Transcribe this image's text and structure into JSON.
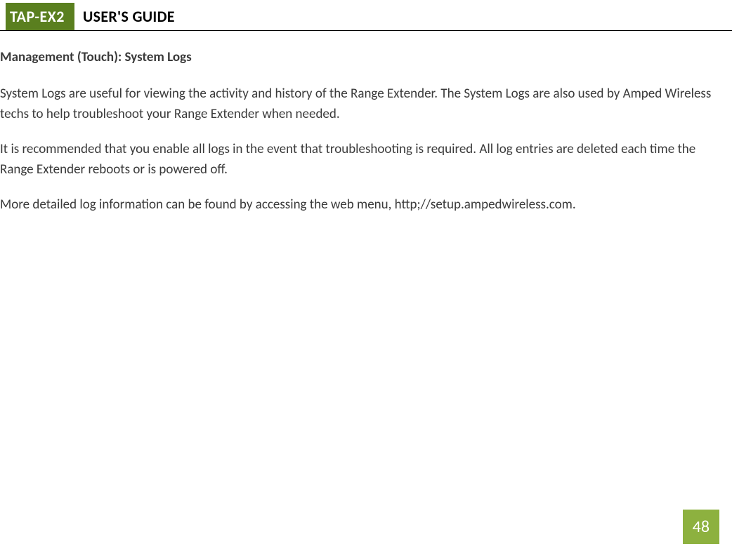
{
  "header": {
    "product": "TAP-EX2",
    "title": "USER'S GUIDE"
  },
  "section": {
    "heading": "Management (Touch): System Logs"
  },
  "paragraphs": {
    "p1": "System Logs are useful for viewing the activity and history of the Range Extender. The System Logs are also used by Amped Wireless techs to help troubleshoot your Range Extender when needed.",
    "p2": "It is recommended that you enable all logs in the event that troubleshooting is required.  All log entries are deleted each time the Range Extender reboots or is powered off.",
    "p3": "More detailed log information can be found by accessing the web menu, http;//setup.ampedwireless.com."
  },
  "page_number": "48"
}
